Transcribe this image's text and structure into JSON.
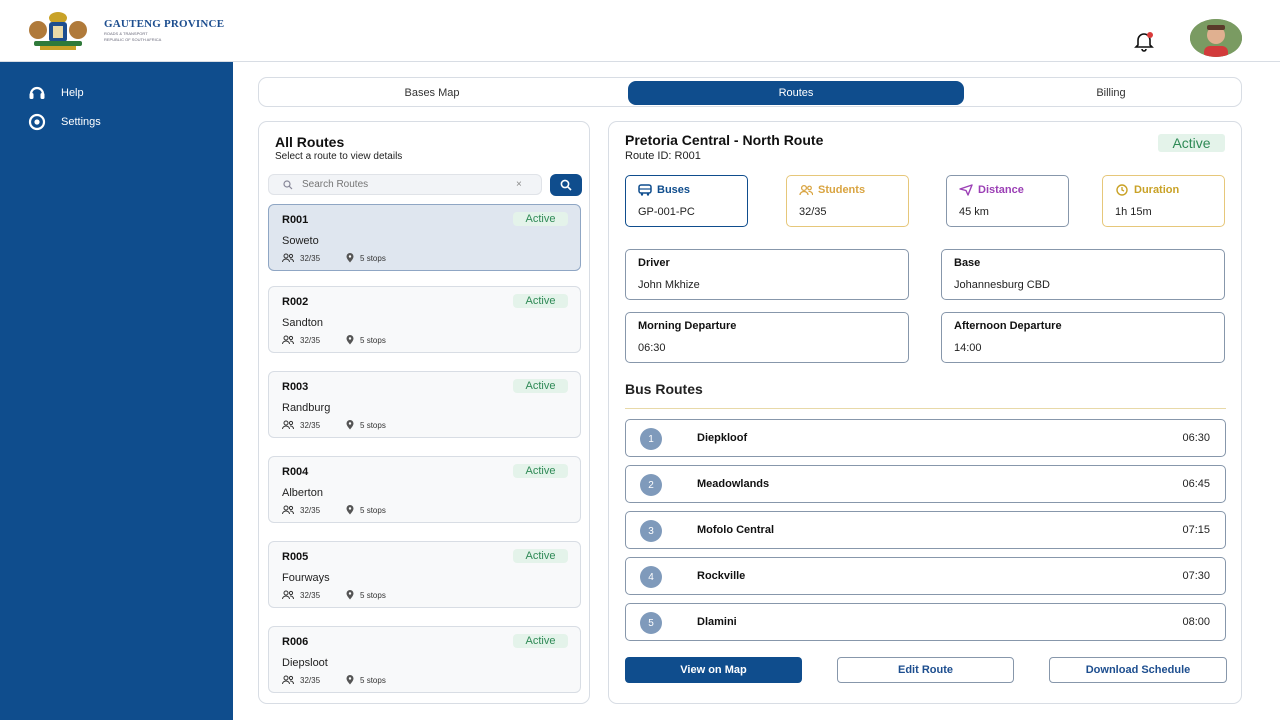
{
  "header": {
    "logo_title": "GAUTENG PROVINCE",
    "logo_subtitle_1": "ROADS & TRANSPORT",
    "logo_subtitle_2": "REPUBLIC OF SOUTH AFRICA"
  },
  "sidebar": {
    "items": [
      {
        "label": "Help",
        "icon": "headset-icon"
      },
      {
        "label": "Settings",
        "icon": "gear-icon"
      }
    ]
  },
  "tabs": [
    {
      "label": "Bases Map",
      "active": false
    },
    {
      "label": "Routes",
      "active": true
    },
    {
      "label": "Billing",
      "active": false
    }
  ],
  "routes_panel": {
    "title": "All Routes",
    "subtitle": "Select a route to view details",
    "search_placeholder": "Search Routes",
    "clear_symbol": "×",
    "routes": [
      {
        "id": "R001",
        "name": "Soweto",
        "status": "Active",
        "students": "32/35",
        "stops": "5 stops",
        "selected": true
      },
      {
        "id": "R002",
        "name": "Sandton",
        "status": "Active",
        "students": "32/35",
        "stops": "5 stops",
        "selected": false
      },
      {
        "id": "R003",
        "name": "Randburg",
        "status": "Active",
        "students": "32/35",
        "stops": "5 stops",
        "selected": false
      },
      {
        "id": "R004",
        "name": "Alberton",
        "status": "Active",
        "students": "32/35",
        "stops": "5 stops",
        "selected": false
      },
      {
        "id": "R005",
        "name": "Fourways",
        "status": "Active",
        "students": "32/35",
        "stops": "5 stops",
        "selected": false
      },
      {
        "id": "R006",
        "name": "Diepsloot",
        "status": "Active",
        "students": "32/35",
        "stops": "5 stops",
        "selected": false
      }
    ]
  },
  "detail": {
    "title": "Pretoria Central - North Route",
    "route_id": "Route ID: R001",
    "status": "Active",
    "stats": {
      "buses": {
        "label": "Buses",
        "value": "GP-001-PC",
        "color": "#0f4d8d"
      },
      "students": {
        "label": "Students",
        "value": "32/35",
        "color": "#d9a441"
      },
      "distance": {
        "label": "Distance",
        "value": "45 km",
        "color": "#9b3fb5"
      },
      "duration": {
        "label": "Duration",
        "value": "1h 15m",
        "color": "#c9a227"
      }
    },
    "info": {
      "driver": {
        "label": "Driver",
        "value": "John Mkhize"
      },
      "base": {
        "label": "Base",
        "value": "Johannesburg CBD"
      },
      "morning": {
        "label": "Morning Departure",
        "value": "06:30"
      },
      "afternoon": {
        "label": "Afternoon Departure",
        "value": "14:00"
      }
    },
    "bus_routes_title": "Bus Routes",
    "stops": [
      {
        "num": "1",
        "name": "Diepkloof",
        "time": "06:30"
      },
      {
        "num": "2",
        "name": "Meadowlands",
        "time": "06:45"
      },
      {
        "num": "3",
        "name": "Mofolo Central",
        "time": "07:15"
      },
      {
        "num": "4",
        "name": "Rockville",
        "time": "07:30"
      },
      {
        "num": "5",
        "name": "Dlamini",
        "time": "08:00"
      }
    ],
    "actions": {
      "view_map": "View on Map",
      "edit_route": "Edit Route",
      "download": "Download Schedule"
    }
  }
}
